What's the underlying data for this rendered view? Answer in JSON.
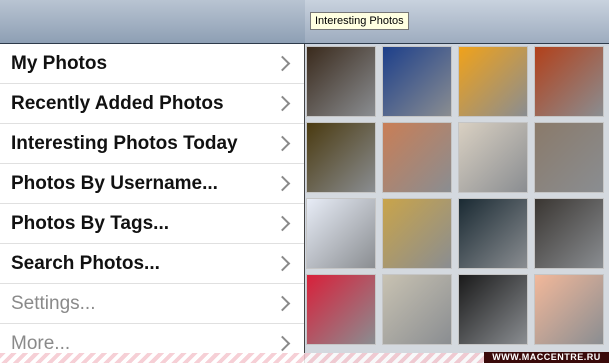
{
  "menu": {
    "items": [
      {
        "label": "My Photos",
        "enabled": true
      },
      {
        "label": "Recently Added Photos",
        "enabled": true
      },
      {
        "label": "Interesting Photos Today",
        "enabled": true
      },
      {
        "label": "Photos By Username...",
        "enabled": true
      },
      {
        "label": "Photos By Tags...",
        "enabled": true
      },
      {
        "label": "Search Photos...",
        "enabled": true
      },
      {
        "label": "Settings...",
        "enabled": false
      },
      {
        "label": "More...",
        "enabled": false
      }
    ]
  },
  "gallery": {
    "tooltip": "Interesting Photos",
    "thumbnails": [
      {
        "bg": "#3a2a1c"
      },
      {
        "bg": "#1d3f8a"
      },
      {
        "bg": "#f0a21a"
      },
      {
        "bg": "#b2401a"
      },
      {
        "bg": "#4a3a10"
      },
      {
        "bg": "#c97e56"
      },
      {
        "bg": "#d9d0c2"
      },
      {
        "bg": "#8a7a6a"
      },
      {
        "bg": "#e7ecf6"
      },
      {
        "bg": "#c9a44a"
      },
      {
        "bg": "#1a2a33"
      },
      {
        "bg": "#3a3632"
      },
      {
        "bg": "#d8203a"
      },
      {
        "bg": "#c8c2b2"
      },
      {
        "bg": "#1a1a1a"
      },
      {
        "bg": "#f2b89a"
      }
    ]
  },
  "watermark": "WWW.MACCENTRE.RU"
}
